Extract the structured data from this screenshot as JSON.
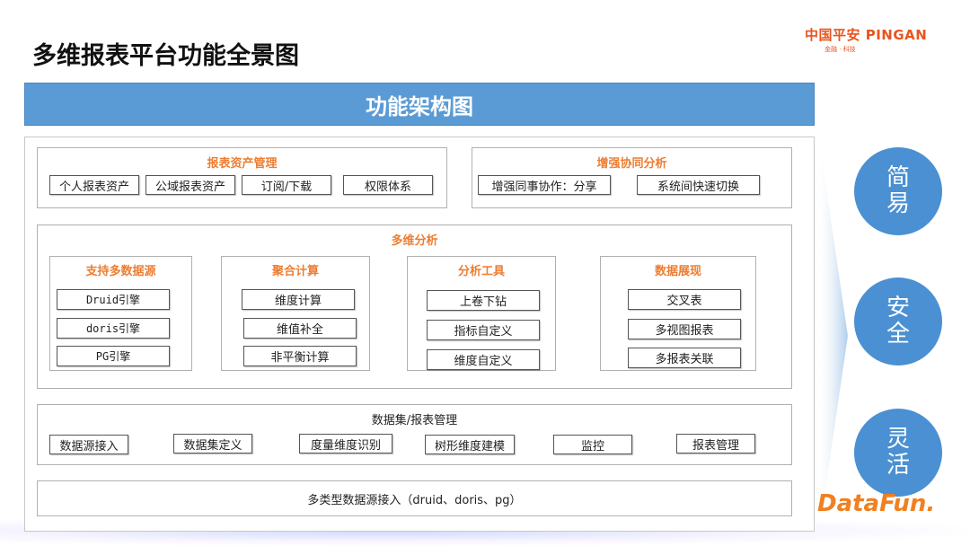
{
  "header": {
    "title": "多维报表平台功能全景图",
    "logo_text": "中国平安 PINGAN",
    "logo_sub": "金融 · 科技"
  },
  "banner": {
    "title": "功能架构图"
  },
  "asset_mgmt": {
    "title": "报表资产管理",
    "items": [
      "个人报表资产",
      "公域报表资产",
      "订阅/下载",
      "权限体系"
    ]
  },
  "collab": {
    "title": "增强协同分析",
    "items": [
      "增强同事协作：分享",
      "系统间快速切换"
    ]
  },
  "multi_analysis": {
    "title": "多维分析",
    "groups": [
      {
        "title": "支持多数据源",
        "items": [
          "Druid引擎",
          "doris引擎",
          "PG引擎"
        ]
      },
      {
        "title": "聚合计算",
        "items": [
          "维度计算",
          "维值补全",
          "非平衡计算"
        ]
      },
      {
        "title": "分析工具",
        "items": [
          "上卷下钻",
          "指标自定义",
          "维度自定义"
        ]
      },
      {
        "title": "数据展现",
        "items": [
          "交叉表",
          "多视图报表",
          "多报表关联"
        ]
      }
    ]
  },
  "dataset_mgmt": {
    "title": "数据集/报表管理",
    "items": [
      "数据源接入",
      "数据集定义",
      "度量维度识别",
      "树形维度建模",
      "监控",
      "报表管理"
    ]
  },
  "data_source": {
    "label": "多类型数据源接入（druid、doris、pg）"
  },
  "qualities": [
    {
      "l1": "简",
      "l2": "易"
    },
    {
      "l1": "安",
      "l2": "全"
    },
    {
      "l1": "灵",
      "l2": "活"
    }
  ],
  "footer": {
    "brand": "DataFun."
  },
  "colors": {
    "banner": "#5b9bd5",
    "accent": "#ed7d31",
    "circle": "#4a90d2"
  }
}
